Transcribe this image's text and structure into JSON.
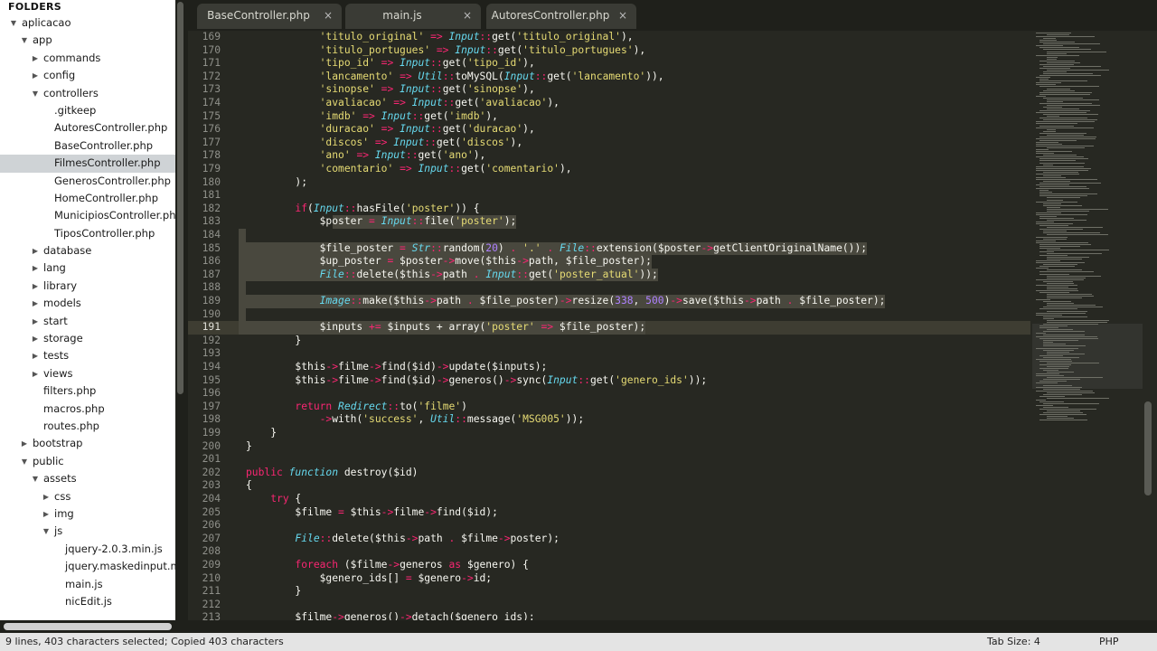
{
  "sidebar": {
    "header": "FOLDERS",
    "items": [
      {
        "label": "aplicacao",
        "depth": 0,
        "arrow": "open"
      },
      {
        "label": "app",
        "depth": 1,
        "arrow": "open"
      },
      {
        "label": "commands",
        "depth": 2,
        "arrow": "closed"
      },
      {
        "label": "config",
        "depth": 2,
        "arrow": "closed"
      },
      {
        "label": "controllers",
        "depth": 2,
        "arrow": "open"
      },
      {
        "label": ".gitkeep",
        "depth": 3,
        "arrow": "none"
      },
      {
        "label": "AutoresController.php",
        "depth": 3,
        "arrow": "none"
      },
      {
        "label": "BaseController.php",
        "depth": 3,
        "arrow": "none"
      },
      {
        "label": "FilmesController.php",
        "depth": 3,
        "arrow": "none",
        "selected": true
      },
      {
        "label": "GenerosController.php",
        "depth": 3,
        "arrow": "none"
      },
      {
        "label": "HomeController.php",
        "depth": 3,
        "arrow": "none"
      },
      {
        "label": "MunicipiosController.php",
        "depth": 3,
        "arrow": "none"
      },
      {
        "label": "TiposController.php",
        "depth": 3,
        "arrow": "none"
      },
      {
        "label": "database",
        "depth": 2,
        "arrow": "closed"
      },
      {
        "label": "lang",
        "depth": 2,
        "arrow": "closed"
      },
      {
        "label": "library",
        "depth": 2,
        "arrow": "closed"
      },
      {
        "label": "models",
        "depth": 2,
        "arrow": "closed"
      },
      {
        "label": "start",
        "depth": 2,
        "arrow": "closed"
      },
      {
        "label": "storage",
        "depth": 2,
        "arrow": "closed"
      },
      {
        "label": "tests",
        "depth": 2,
        "arrow": "closed"
      },
      {
        "label": "views",
        "depth": 2,
        "arrow": "closed"
      },
      {
        "label": "filters.php",
        "depth": 2,
        "arrow": "none"
      },
      {
        "label": "macros.php",
        "depth": 2,
        "arrow": "none"
      },
      {
        "label": "routes.php",
        "depth": 2,
        "arrow": "none"
      },
      {
        "label": "bootstrap",
        "depth": 1,
        "arrow": "closed"
      },
      {
        "label": "public",
        "depth": 1,
        "arrow": "open"
      },
      {
        "label": "assets",
        "depth": 2,
        "arrow": "open"
      },
      {
        "label": "css",
        "depth": 3,
        "arrow": "closed"
      },
      {
        "label": "img",
        "depth": 3,
        "arrow": "closed"
      },
      {
        "label": "js",
        "depth": 3,
        "arrow": "open"
      },
      {
        "label": "jquery-2.0.3.min.js",
        "depth": 4,
        "arrow": "none"
      },
      {
        "label": "jquery.maskedinput.m",
        "depth": 4,
        "arrow": "none"
      },
      {
        "label": "main.js",
        "depth": 4,
        "arrow": "none"
      },
      {
        "label": "nicEdit.js",
        "depth": 4,
        "arrow": "none"
      }
    ]
  },
  "tabs": [
    {
      "label": "BaseController.php",
      "active": false
    },
    {
      "label": "main.js",
      "active": false
    },
    {
      "label": "AutoresController.php",
      "active": false
    }
  ],
  "tab_close_glyph": "×",
  "editor": {
    "current_line": 191,
    "selection": {
      "from": 183,
      "to": 191
    },
    "lines": [
      {
        "n": 169,
        "code": "            'titulo_original' => Input::get('titulo_original'),"
      },
      {
        "n": 170,
        "code": "            'titulo_portugues' => Input::get('titulo_portugues'),"
      },
      {
        "n": 171,
        "code": "            'tipo_id' => Input::get('tipo_id'),"
      },
      {
        "n": 172,
        "code": "            'lancamento' => Util::toMySQL(Input::get('lancamento')),"
      },
      {
        "n": 173,
        "code": "            'sinopse' => Input::get('sinopse'),"
      },
      {
        "n": 174,
        "code": "            'avaliacao' => Input::get('avaliacao'),"
      },
      {
        "n": 175,
        "code": "            'imdb' => Input::get('imdb'),"
      },
      {
        "n": 176,
        "code": "            'duracao' => Input::get('duracao'),"
      },
      {
        "n": 177,
        "code": "            'discos' => Input::get('discos'),"
      },
      {
        "n": 178,
        "code": "            'ano' => Input::get('ano'),"
      },
      {
        "n": 179,
        "code": "            'comentario' => Input::get('comentario'),"
      },
      {
        "n": 180,
        "code": "        );"
      },
      {
        "n": 181,
        "code": ""
      },
      {
        "n": 182,
        "code": "        if(Input::hasFile('poster')) {"
      },
      {
        "n": 183,
        "code": "            $poster = Input::file('poster');"
      },
      {
        "n": 184,
        "code": ""
      },
      {
        "n": 185,
        "code": "            $file_poster = Str::random(20) . '.' . File::extension($poster->getClientOriginalName());"
      },
      {
        "n": 186,
        "code": "            $up_poster = $poster->move($this->path, $file_poster);"
      },
      {
        "n": 187,
        "code": "            File::delete($this->path . Input::get('poster_atual'));"
      },
      {
        "n": 188,
        "code": ""
      },
      {
        "n": 189,
        "code": "            Image::make($this->path . $file_poster)->resize(338, 500)->save($this->path . $file_poster);"
      },
      {
        "n": 190,
        "code": ""
      },
      {
        "n": 191,
        "code": "            $inputs += $inputs + array('poster' => $file_poster);"
      },
      {
        "n": 192,
        "code": "        }"
      },
      {
        "n": 193,
        "code": ""
      },
      {
        "n": 194,
        "code": "        $this->filme->find($id)->update($inputs);"
      },
      {
        "n": 195,
        "code": "        $this->filme->find($id)->generos()->sync(Input::get('genero_ids'));"
      },
      {
        "n": 196,
        "code": ""
      },
      {
        "n": 197,
        "code": "        return Redirect::to('filme')"
      },
      {
        "n": 198,
        "code": "            ->with('success', Util::message('MSG005'));"
      },
      {
        "n": 199,
        "code": "    }"
      },
      {
        "n": 200,
        "code": "}"
      },
      {
        "n": 201,
        "code": ""
      },
      {
        "n": 202,
        "code": "public function destroy($id)"
      },
      {
        "n": 203,
        "code": "{"
      },
      {
        "n": 204,
        "code": "    try {"
      },
      {
        "n": 205,
        "code": "        $filme = $this->filme->find($id);"
      },
      {
        "n": 206,
        "code": ""
      },
      {
        "n": 207,
        "code": "        File::delete($this->path . $filme->poster);"
      },
      {
        "n": 208,
        "code": ""
      },
      {
        "n": 209,
        "code": "        foreach ($filme->generos as $genero) {"
      },
      {
        "n": 210,
        "code": "            $genero_ids[] = $genero->id;"
      },
      {
        "n": 211,
        "code": "        }"
      },
      {
        "n": 212,
        "code": ""
      },
      {
        "n": 213,
        "code": "        $filme->generos()->detach($genero_ids);"
      }
    ]
  },
  "status": {
    "message": "9 lines, 403 characters selected; Copied 403 characters",
    "tab_size": "Tab Size: 4",
    "syntax": "PHP"
  },
  "colors": {
    "bg": "#272822",
    "keyword": "#f92672",
    "string": "#e6db74",
    "class": "#66d9ef",
    "number": "#ae81ff"
  }
}
